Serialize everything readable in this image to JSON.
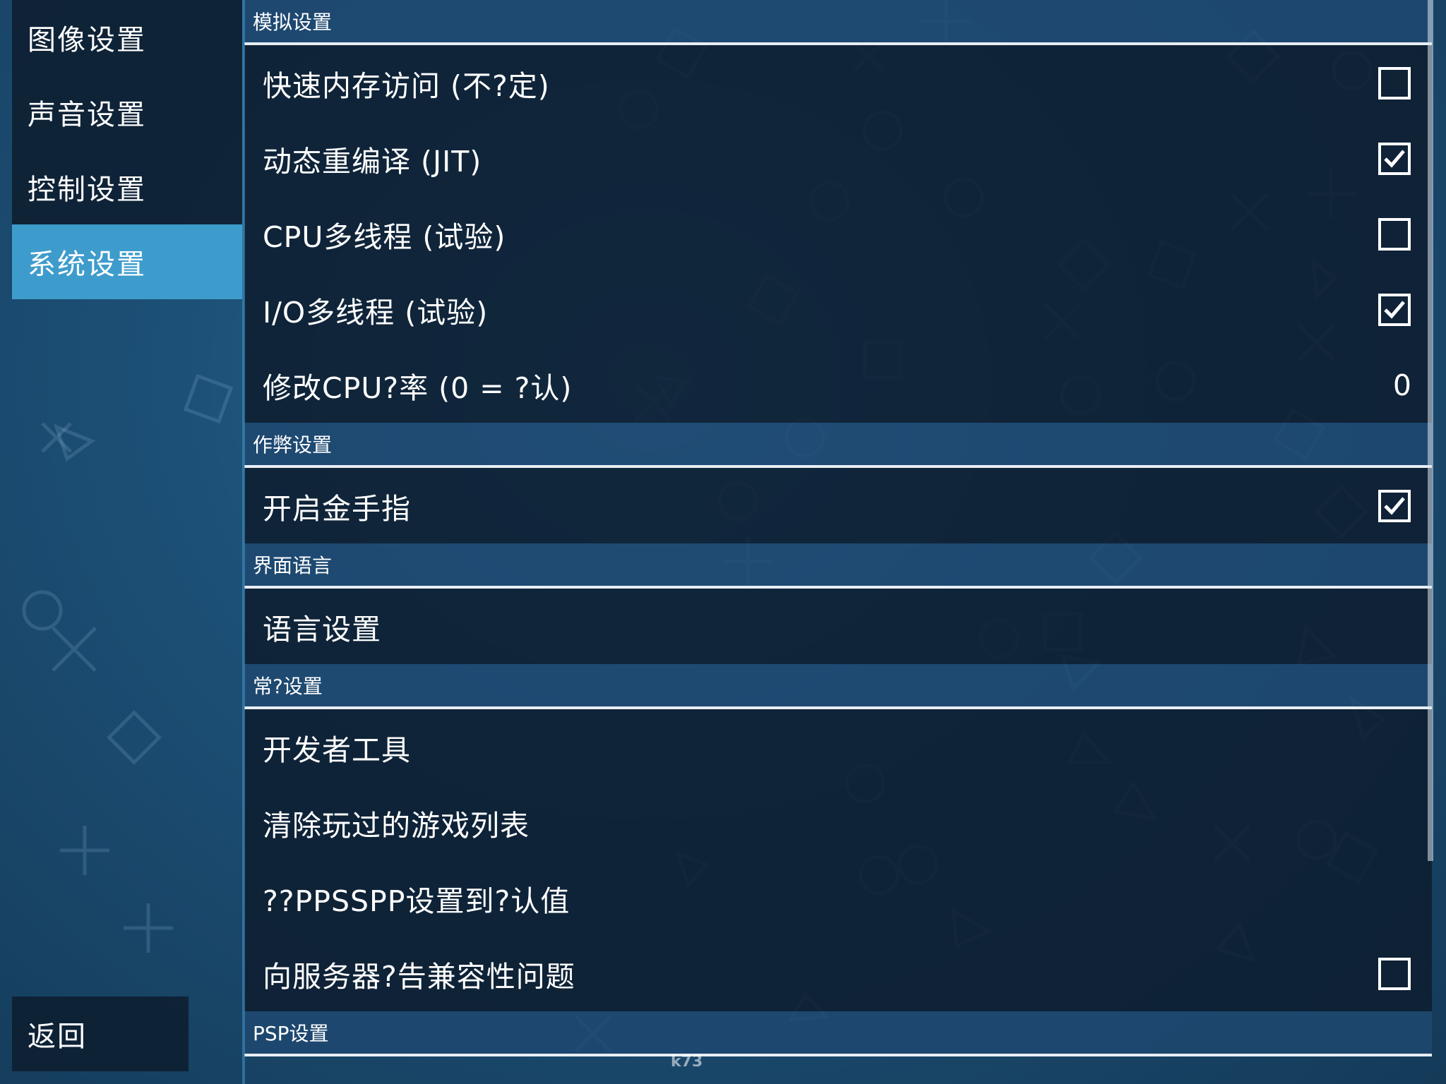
{
  "sidebar": {
    "tabs": [
      {
        "label": "图像设置",
        "active": false
      },
      {
        "label": "声音设置",
        "active": false
      },
      {
        "label": "控制设置",
        "active": false
      },
      {
        "label": "系统设置",
        "active": true
      }
    ],
    "back_label": "返回"
  },
  "sections": [
    {
      "title": "模拟设置",
      "rows": [
        {
          "label": "快速内存访问 (不?定)",
          "control": "checkbox",
          "checked": false
        },
        {
          "label": "动态重编译 (JIT)",
          "control": "checkbox",
          "checked": true
        },
        {
          "label": "CPU多线程 (试验)",
          "control": "checkbox",
          "checked": false
        },
        {
          "label": "I/O多线程 (试验)",
          "control": "checkbox",
          "checked": true
        },
        {
          "label": "修改CPU?率 (0 = ?认)",
          "control": "value",
          "value": "0"
        }
      ]
    },
    {
      "title": "作弊设置",
      "rows": [
        {
          "label": "开启金手指",
          "control": "checkbox",
          "checked": true
        }
      ]
    },
    {
      "title": "界面语言",
      "rows": [
        {
          "label": "语言设置",
          "control": "none"
        }
      ]
    },
    {
      "title": "常?设置",
      "rows": [
        {
          "label": "开发者工具",
          "control": "none"
        },
        {
          "label": "清除玩过的游戏列表",
          "control": "none"
        },
        {
          "label": "??PPSSPP设置到?认值",
          "control": "none"
        },
        {
          "label": "向服务器?告兼容性问题",
          "control": "checkbox",
          "checked": false
        }
      ]
    },
    {
      "title": "PSP设置",
      "rows": []
    }
  ],
  "watermark": "k73",
  "colors": {
    "active_tab": "#3e9ccc",
    "panel": "#0e1e30",
    "background": "#1d5178"
  }
}
